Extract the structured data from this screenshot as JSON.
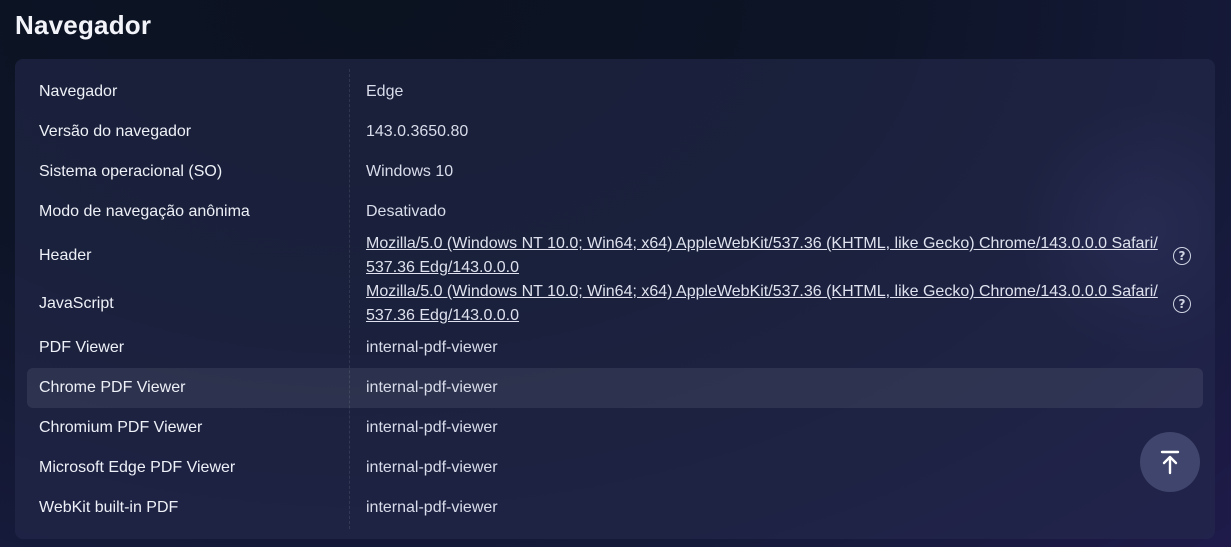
{
  "page": {
    "title": "Navegador"
  },
  "rows": [
    {
      "label": "Navegador",
      "value": "Edge"
    },
    {
      "label": "Versão do navegador",
      "value": "143.0.3650.80"
    },
    {
      "label": "Sistema operacional (SO)",
      "value": "Windows 10"
    },
    {
      "label": "Modo de navegação anônima",
      "value": "Desativado"
    },
    {
      "label": "Header",
      "value": "Mozilla/5.0 (Windows NT 10.0; Win64; x64) AppleWebKit/537.36 (KHTML, like Gecko) Chrome/143.0.0.0 Safari/537.36 Edg/143.0.0.0"
    },
    {
      "label": "JavaScript",
      "value": "Mozilla/5.0 (Windows NT 10.0; Win64; x64) AppleWebKit/537.36 (KHTML, like Gecko) Chrome/143.0.0.0 Safari/537.36 Edg/143.0.0.0"
    },
    {
      "label": "PDF Viewer",
      "value": "internal-pdf-viewer"
    },
    {
      "label": "Chrome PDF Viewer",
      "value": "internal-pdf-viewer"
    },
    {
      "label": "Chromium PDF Viewer",
      "value": "internal-pdf-viewer"
    },
    {
      "label": "Microsoft Edge PDF Viewer",
      "value": "internal-pdf-viewer"
    },
    {
      "label": "WebKit built-in PDF",
      "value": "internal-pdf-viewer"
    }
  ],
  "icons": {
    "help": "help-circle-icon",
    "scroll_top": "arrow-up-to-top-icon"
  },
  "colors": {
    "background": "#0d1426",
    "panel": "#262c4e",
    "highlight_row": "#3a4060"
  }
}
